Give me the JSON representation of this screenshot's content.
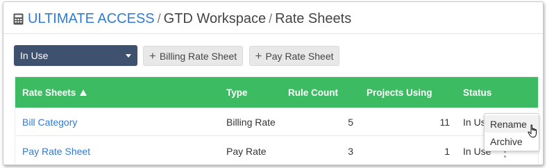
{
  "breadcrumb": {
    "root": "ULTIMATE ACCESS",
    "separator": "/",
    "items": [
      "GTD Workspace",
      "Rate Sheets"
    ]
  },
  "toolbar": {
    "filter_selected": "In Use",
    "billing_button": "Billing Rate Sheet",
    "pay_button": "Pay Rate Sheet"
  },
  "table": {
    "columns": [
      "Rate Sheets",
      "Type",
      "Rule Count",
      "Projects Using",
      "Status"
    ],
    "sort_column": "Rate Sheets",
    "sort_direction": "ascending",
    "rows": [
      {
        "name": "Bill Category",
        "type": "Billing Rate",
        "rule_count": "5",
        "projects_using": "11",
        "status": "In Use"
      },
      {
        "name": "Pay Rate Sheet",
        "type": "Pay Rate",
        "rule_count": "3",
        "projects_using": "1",
        "status": "In Use"
      }
    ]
  },
  "context_menu": {
    "items": [
      "Rename",
      "Archive"
    ]
  },
  "colors": {
    "accent_link": "#2f7bd6",
    "header_green": "#3dbb63",
    "select_bg": "#3e5270"
  }
}
